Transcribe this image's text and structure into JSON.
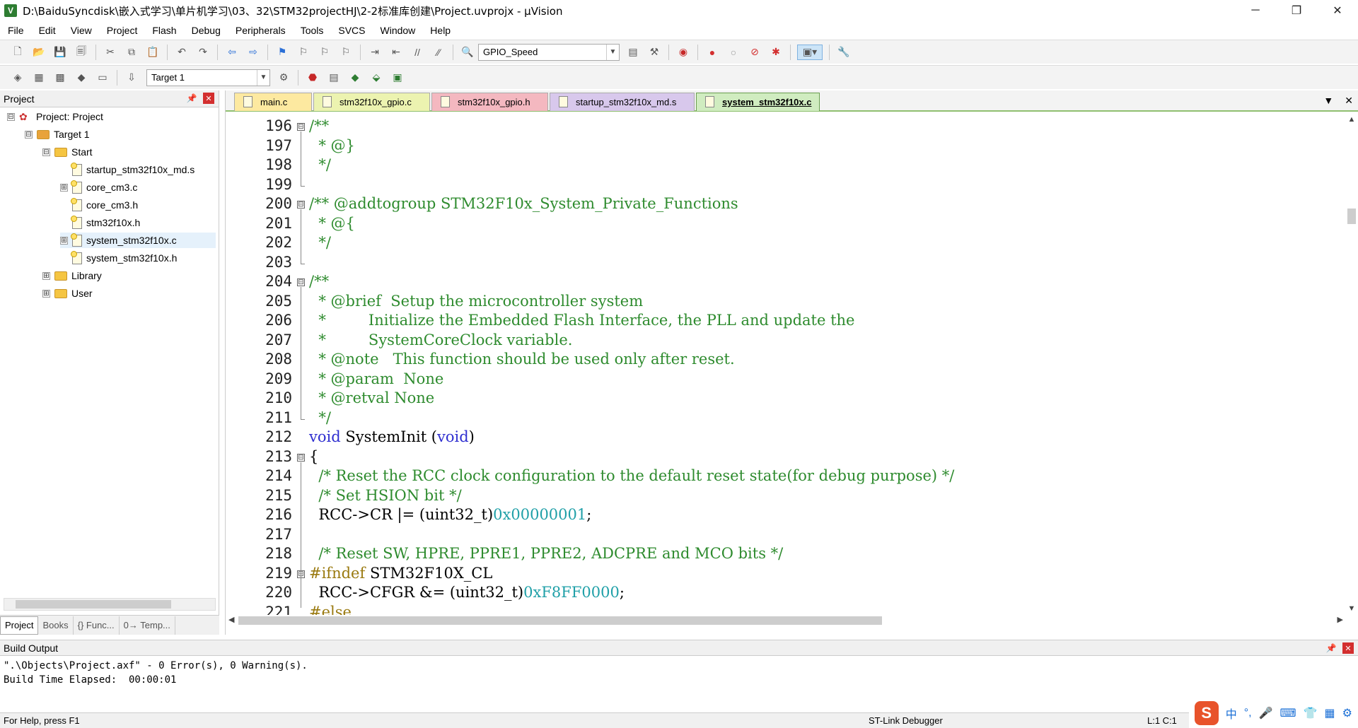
{
  "window": {
    "title": "D:\\BaiduSyncdisk\\嵌入式学习\\单片机学习\\03、32\\STM32projectHJ\\2-2标准库创建\\Project.uvprojx - µVision",
    "app_icon": "V",
    "minimize": "─",
    "restore": "❐",
    "close": "✕"
  },
  "menu": [
    "File",
    "Edit",
    "View",
    "Project",
    "Flash",
    "Debug",
    "Peripherals",
    "Tools",
    "SVCS",
    "Window",
    "Help"
  ],
  "toolbar1": {
    "find_combo": "GPIO_Speed"
  },
  "toolbar2": {
    "target_combo": "Target 1"
  },
  "project_panel": {
    "title": "Project",
    "tree": [
      {
        "label": "Project: Project",
        "level": 0,
        "expander": "⊟",
        "kind": "project"
      },
      {
        "label": "Target 1",
        "level": 1,
        "expander": "⊟",
        "kind": "target"
      },
      {
        "label": "Start",
        "level": 2,
        "expander": "⊟",
        "kind": "folder"
      },
      {
        "label": "startup_stm32f10x_md.s",
        "level": 3,
        "expander": "",
        "kind": "file"
      },
      {
        "label": "core_cm3.c",
        "level": 3,
        "expander": "⊞",
        "kind": "file"
      },
      {
        "label": "core_cm3.h",
        "level": 3,
        "expander": "",
        "kind": "file"
      },
      {
        "label": "stm32f10x.h",
        "level": 3,
        "expander": "",
        "kind": "file"
      },
      {
        "label": "system_stm32f10x.c",
        "level": 3,
        "expander": "⊞",
        "kind": "file",
        "selected": true
      },
      {
        "label": "system_stm32f10x.h",
        "level": 3,
        "expander": "",
        "kind": "file"
      },
      {
        "label": "Library",
        "level": 2,
        "expander": "⊞",
        "kind": "folder"
      },
      {
        "label": "User",
        "level": 2,
        "expander": "⊞",
        "kind": "folder"
      }
    ],
    "bottom_tabs": [
      "Project",
      "Books",
      "{} Func...",
      "0→ Temp..."
    ]
  },
  "editor": {
    "tabs": [
      {
        "label": "main.c",
        "color": "#fde9a0"
      },
      {
        "label": "stm32f10x_gpio.c",
        "color": "#ecf3b0"
      },
      {
        "label": "stm32f10x_gpio.h",
        "color": "#f4b8c0"
      },
      {
        "label": "startup_stm32f10x_md.s",
        "color": "#d8c8ec"
      },
      {
        "label": "system_stm32f10x.c",
        "color": "#d0ecc0",
        "active": true
      }
    ],
    "lines": [
      {
        "n": "196",
        "fold": "⊟",
        "segs": [
          [
            "cm",
            "/**"
          ]
        ]
      },
      {
        "n": "197",
        "fold": "",
        "segs": [
          [
            "cm",
            "  * @}"
          ]
        ]
      },
      {
        "n": "198",
        "fold": "",
        "segs": [
          [
            "cm",
            "  */"
          ]
        ]
      },
      {
        "n": "199",
        "fold": "",
        "segs": []
      },
      {
        "n": "200",
        "fold": "⊟",
        "segs": [
          [
            "cm",
            "/** @addtogroup STM32F10x_System_Private_Functions"
          ]
        ]
      },
      {
        "n": "201",
        "fold": "",
        "segs": [
          [
            "cm",
            "  * @{"
          ]
        ]
      },
      {
        "n": "202",
        "fold": "",
        "segs": [
          [
            "cm",
            "  */"
          ]
        ]
      },
      {
        "n": "203",
        "fold": "",
        "segs": []
      },
      {
        "n": "204",
        "fold": "⊟",
        "segs": [
          [
            "cm",
            "/**"
          ]
        ]
      },
      {
        "n": "205",
        "fold": "",
        "segs": [
          [
            "cm",
            "  * @brief  Setup the microcontroller system"
          ]
        ]
      },
      {
        "n": "206",
        "fold": "",
        "segs": [
          [
            "cm",
            "  *         Initialize the Embedded Flash Interface, the PLL and update the"
          ]
        ]
      },
      {
        "n": "207",
        "fold": "",
        "segs": [
          [
            "cm",
            "  *         SystemCoreClock variable."
          ]
        ]
      },
      {
        "n": "208",
        "fold": "",
        "segs": [
          [
            "cm",
            "  * @note   This function should be used only after reset."
          ]
        ]
      },
      {
        "n": "209",
        "fold": "",
        "segs": [
          [
            "cm",
            "  * @param  None"
          ]
        ]
      },
      {
        "n": "210",
        "fold": "",
        "segs": [
          [
            "cm",
            "  * @retval None"
          ]
        ]
      },
      {
        "n": "211",
        "fold": "",
        "segs": [
          [
            "cm",
            "  */"
          ]
        ]
      },
      {
        "n": "212",
        "fold": "",
        "segs": [
          [
            "kw",
            "void"
          ],
          [
            "plain",
            " SystemInit ("
          ],
          [
            "kw",
            "void"
          ],
          [
            "plain",
            ")"
          ]
        ]
      },
      {
        "n": "213",
        "fold": "⊟",
        "segs": [
          [
            "plain",
            "{"
          ]
        ]
      },
      {
        "n": "214",
        "fold": "",
        "segs": [
          [
            "cm",
            "  /* Reset the RCC clock configuration to the default reset state(for debug purpose) */"
          ]
        ]
      },
      {
        "n": "215",
        "fold": "",
        "segs": [
          [
            "cm",
            "  /* Set HSION bit */"
          ]
        ]
      },
      {
        "n": "216",
        "fold": "",
        "segs": [
          [
            "plain",
            "  RCC->CR |= (uint32_t)"
          ],
          [
            "num",
            "0x00000001"
          ],
          [
            "plain",
            ";"
          ]
        ]
      },
      {
        "n": "217",
        "fold": "",
        "segs": []
      },
      {
        "n": "218",
        "fold": "",
        "segs": [
          [
            "cm",
            "  /* Reset SW, HPRE, PPRE1, PPRE2, ADCPRE and MCO bits */"
          ]
        ]
      },
      {
        "n": "219",
        "fold": "⊟",
        "segs": [
          [
            "pp",
            "#ifndef"
          ],
          [
            "plain",
            " STM32F10X_CL"
          ]
        ]
      },
      {
        "n": "220",
        "fold": "",
        "segs": [
          [
            "plain",
            "  RCC->CFGR &= (uint32_t)"
          ],
          [
            "num",
            "0xF8FF0000"
          ],
          [
            "plain",
            ";"
          ]
        ]
      },
      {
        "n": "221",
        "fold": "",
        "segs": [
          [
            "pp",
            "#else"
          ]
        ]
      }
    ]
  },
  "build_output": {
    "title": "Build Output",
    "line1": "\".\\Objects\\Project.axf\" - 0 Error(s), 0 Warning(s).",
    "line2": "Build Time Elapsed:  00:00:01"
  },
  "status": {
    "help": "For Help, press F1",
    "debugger": "ST-Link Debugger",
    "position": "L:1 C:1"
  },
  "ime": {
    "logo": "S",
    "items": [
      "中",
      "°,",
      "🎤",
      "⌨",
      "👕",
      "▦",
      "⚙"
    ]
  }
}
